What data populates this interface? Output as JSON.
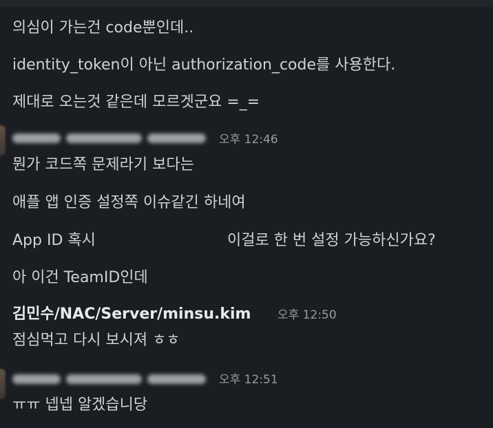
{
  "messages_top": [
    "의심이 가는건 code뿐인데..",
    "identity_token이 아닌 authorization_code를 사용한다.",
    "제대로 오는것 같은데 모르겟군요 =_="
  ],
  "group1": {
    "timestamp": "오후 12:46",
    "messages": [
      "뭔가 코드쪽 문제라기 보다는",
      "애플 앱 인증 설정쪽 이슈같긴 하네여"
    ],
    "app_id_prefix": "App ID 혹시",
    "app_id_suffix": "이걸로 한 번 설정 가능하신가요?",
    "last": "아 이건 TeamID인데"
  },
  "group2": {
    "sender": "김민수/NAC/Server/minsu.kim",
    "timestamp": "오후 12:50",
    "message": "점심먹고 다시 보시져 ㅎㅎ"
  },
  "group3": {
    "timestamp": "오후 12:51",
    "message": "ㅠㅠ 넵넵 알겠습니당"
  }
}
